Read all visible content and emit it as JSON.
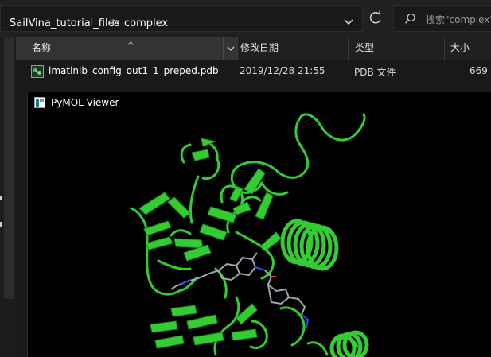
{
  "explorer": {
    "breadcrumb": [
      "SailVina_tutorial_files",
      "complex"
    ],
    "breadcrumb_separator": ">",
    "search_placeholder": "搜索\"complex\"",
    "columns": {
      "name": "名称",
      "date": "修改日期",
      "type": "类型",
      "size": "大小"
    },
    "files": [
      {
        "name": "imatinib_config_out1_1_preped.pdb",
        "date": "2019/12/28 21:55",
        "type": "PDB 文件",
        "size": "669"
      }
    ]
  },
  "pymol": {
    "title": "PyMOL Viewer",
    "cartoon_color": "#33cc33",
    "background_color": "#000000"
  },
  "icons": {
    "address_dropdown": "chevron-down-icon",
    "refresh": "refresh-icon",
    "search": "search-icon",
    "sort": "sort-caret-icon",
    "file": "pdb-file-icon",
    "app": "pymol-logo-icon"
  }
}
